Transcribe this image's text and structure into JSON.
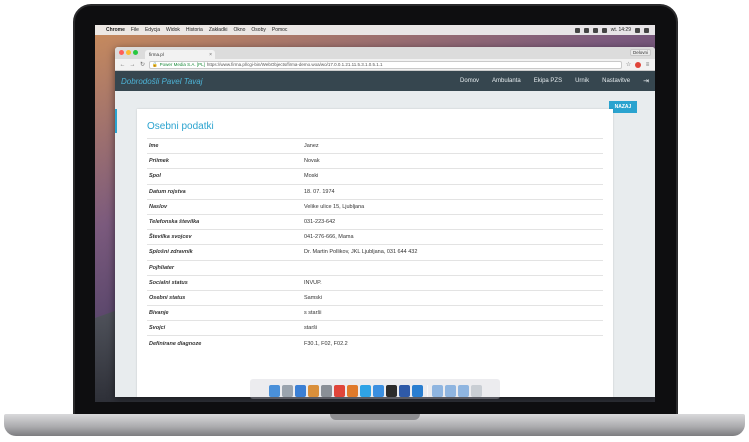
{
  "menubar": {
    "items": [
      "Chrome",
      "File",
      "Edycja",
      "Widok",
      "Historia",
      "Zakładki",
      "Okno",
      "Osoby",
      "Pomoc"
    ],
    "clock": "wt. 14:29"
  },
  "browser": {
    "tab_title": "firma.pl",
    "profile_label": "Delovni",
    "url_owner": "Power Media S.A. [PL]",
    "url": "https://www.firma.pl/cgi-bin/WebObjects/firma-demo.woa/wo/17.0.0.1.21.11.5.3.1.0.5.1.1"
  },
  "app": {
    "brand": "Dobrodošli Pavel Tavaj",
    "nav": [
      "Domov",
      "Ambulanta",
      "Ekipa PZS",
      "Urnik",
      "Nastavitve"
    ],
    "back_button": "NAZAJ",
    "section_title": "Osebni podatki",
    "rows": [
      {
        "label": "Ime",
        "value": "Janez"
      },
      {
        "label": "Priimek",
        "value": "Novak"
      },
      {
        "label": "Spol",
        "value": "Moski"
      },
      {
        "label": "Datum rojstva",
        "value": "18. 07. 1974"
      },
      {
        "label": "Naslov",
        "value": "Velike ulice 15, Ljubljana"
      },
      {
        "label": "Telefonska številka",
        "value": "031-223-642"
      },
      {
        "label": "Številka svojcev",
        "value": "041-276-666, Mama"
      },
      {
        "label": "Splošni zdravnik",
        "value": "Dr. Martin Pollikov, JKL Ljubljana, 031 644 432"
      },
      {
        "label": "Pojhliater",
        "value": ""
      },
      {
        "label": "Socialni status",
        "value": "INVUP."
      },
      {
        "label": "Osebni status",
        "value": "Samski"
      },
      {
        "label": "Bivanje",
        "value": "s starši"
      },
      {
        "label": "Svojci",
        "value": "starši"
      },
      {
        "label": "Definirane diagnoze",
        "value": "F30.1, F02, F02.2"
      }
    ]
  },
  "dock_icons": [
    "finder-icon",
    "launchpad-icon",
    "safari-icon",
    "photos-icon",
    "settings-icon",
    "chrome-icon",
    "firefox-icon",
    "skype-icon",
    "appstore-icon",
    "terminal-icon",
    "word-icon",
    "photoshop-icon",
    "folder-icon",
    "folder-icon-2",
    "folder-icon-3",
    "trash-icon"
  ],
  "colors": {
    "navbar": "#36464f",
    "accent": "#2aa3cf"
  }
}
